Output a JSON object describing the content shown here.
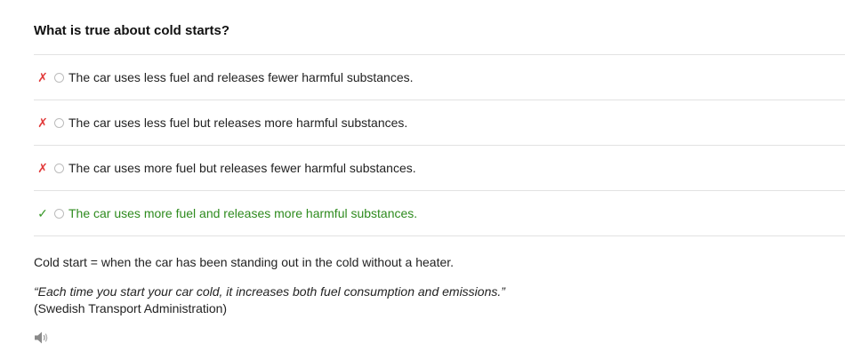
{
  "question": "What is true about cold starts?",
  "options": [
    {
      "text": "The car uses less fuel and releases fewer harmful substances.",
      "mark": "✗",
      "status": "wrong"
    },
    {
      "text": "The car uses less fuel but releases more harmful substances.",
      "mark": "✗",
      "status": "wrong"
    },
    {
      "text": "The car uses more fuel but releases fewer harmful substances.",
      "mark": "✗",
      "status": "wrong"
    },
    {
      "text": "The car uses more fuel and releases more harmful substances.",
      "mark": "✓",
      "status": "correct"
    }
  ],
  "explanation": "Cold start = when the car has been standing out in the cold without a heater.",
  "quote": {
    "text": "“Each time you start your car cold, it increases both fuel consumption and emissions.”",
    "source": "(Swedish Transport Administration)"
  },
  "icons": {
    "audio": "speaker-icon"
  },
  "colors": {
    "wrong": "#e23b3b",
    "correct": "#2e8b1e"
  }
}
